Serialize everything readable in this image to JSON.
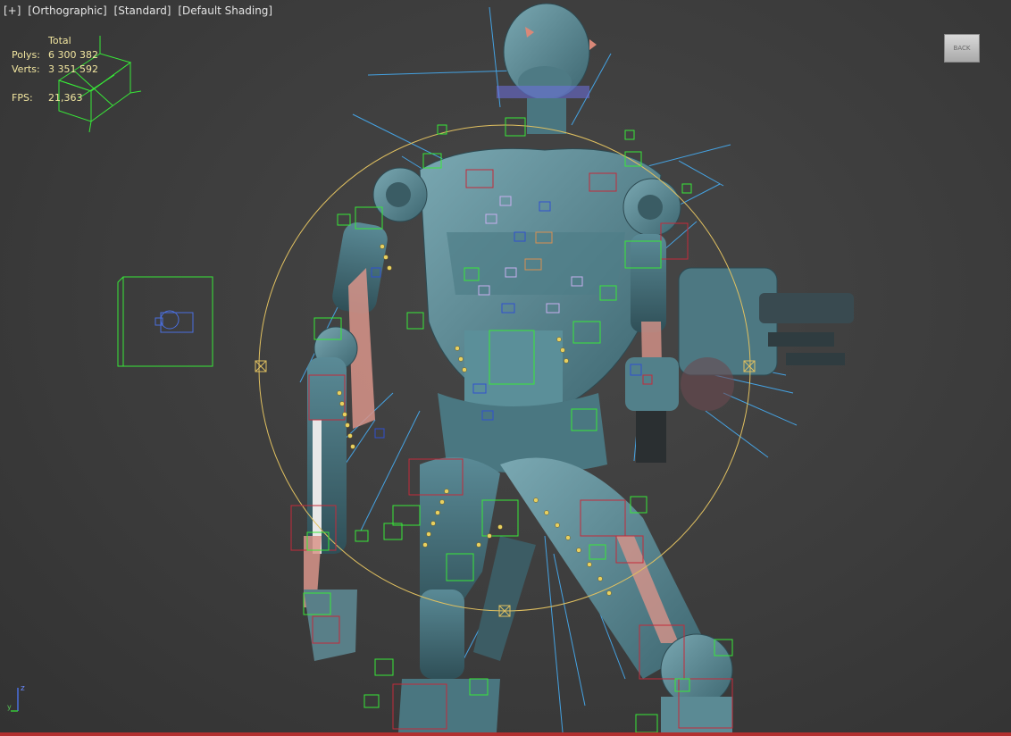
{
  "viewport": {
    "labels": [
      "[+]",
      "[Orthographic]",
      "[Standard]",
      "[Default Shading]"
    ]
  },
  "stats": {
    "header": "Total",
    "polys_label": "Polys:",
    "polys_value": "6 300 382",
    "verts_label": "Verts:",
    "verts_value": "3 351 592",
    "fps_label": "FPS:",
    "fps_value": "21,363"
  },
  "viewcube": {
    "label": "BACK"
  },
  "axis": {
    "z_label": "z",
    "y_label": "y"
  },
  "colors": {
    "background": "#3c3c3c",
    "mesh": "#5a8a96",
    "mesh_dark": "#3f6670",
    "selection_green": "#38e838",
    "bone_red": "#c42a3a",
    "helper_blue": "#46b4ff",
    "gizmo_yellow": "#e0c060",
    "stats_text": "#f2e6a0"
  }
}
